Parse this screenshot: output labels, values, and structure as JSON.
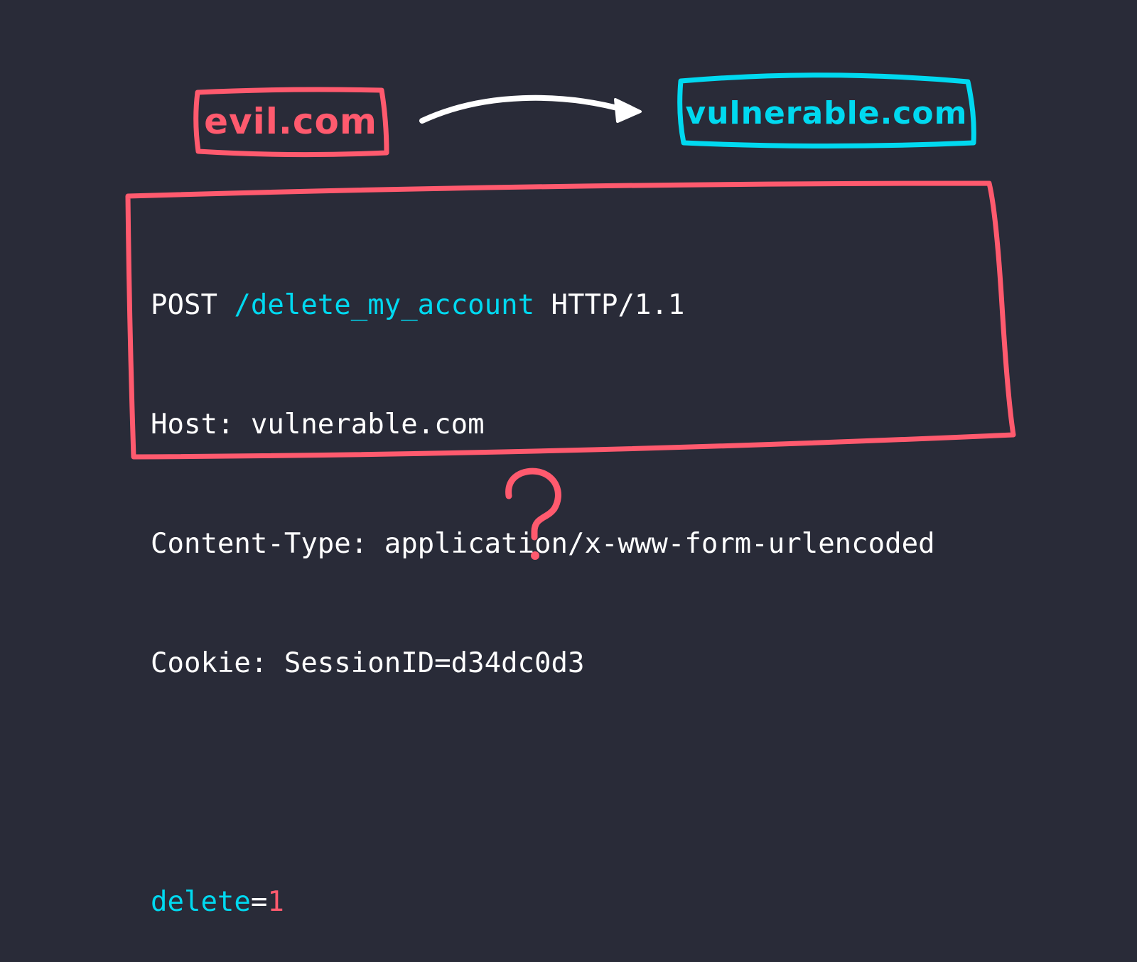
{
  "colors": {
    "background": "#292b38",
    "attacker": "#ff5a6e",
    "target": "#00d9f0",
    "arrow": "#ffffff"
  },
  "diagram": {
    "source_label": "evil.com",
    "target_label": "vulnerable.com",
    "question_mark": "?"
  },
  "request": {
    "method": "POST",
    "path": "/delete_my_account",
    "protocol": "HTTP/1.1",
    "host_line": "Host: vulnerable.com",
    "content_type_line": "Content-Type: application/x-www-form-urlencoded",
    "cookie_line": "Cookie: SessionID=d34dc0d3",
    "body_key": "delete",
    "body_equals": "=",
    "body_value": "1"
  }
}
